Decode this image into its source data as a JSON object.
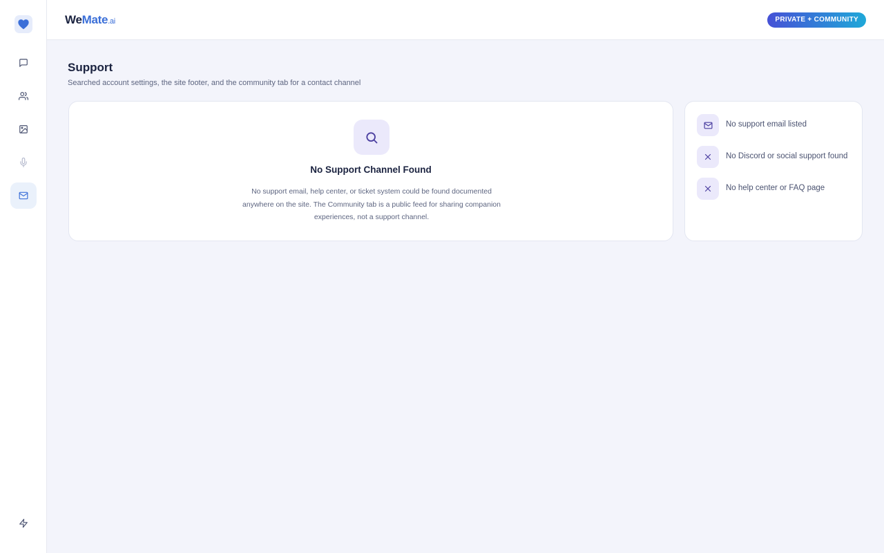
{
  "brand": {
    "part1": "We",
    "part2": "Mate",
    "suffix": ".ai"
  },
  "mode_badge": "PRIVATE + COMMUNITY",
  "sidebar": {
    "items": [
      {
        "name": "chat",
        "icon": "chat-bubble-icon",
        "active": false
      },
      {
        "name": "people",
        "icon": "users-icon",
        "active": false
      },
      {
        "name": "gallery",
        "icon": "image-icon",
        "active": false
      },
      {
        "name": "voice",
        "icon": "microphone-icon",
        "active": false
      },
      {
        "name": "support",
        "icon": "mail-icon",
        "active": true
      }
    ],
    "bottom_icon": "bolt-icon"
  },
  "page": {
    "title": "Support",
    "subtitle": "Searched account settings, the site footer, and the community tab for a contact channel"
  },
  "empty_state": {
    "icon": "search-icon",
    "title": "No Support Channel Found",
    "body": "No support email, help center, or ticket system could be found documented anywhere on the site. The Community tab is a public feed for sharing companion experiences, not a support channel."
  },
  "checklist": [
    {
      "icon": "mail-icon",
      "label": "No support email listed"
    },
    {
      "icon": "x-icon",
      "label": "No Discord or social support found"
    },
    {
      "icon": "x-icon",
      "label": "No help center or FAQ page"
    }
  ],
  "colors": {
    "accent": "#3b6fd8",
    "heart": "#3b6fd8",
    "page_bg": "#f3f4fb",
    "icon_tile": "#ebe9fb",
    "icon_stroke": "#4b3fa0",
    "badge_gradient_start": "#4651d6",
    "badge_gradient_end": "#1fa8d8"
  }
}
